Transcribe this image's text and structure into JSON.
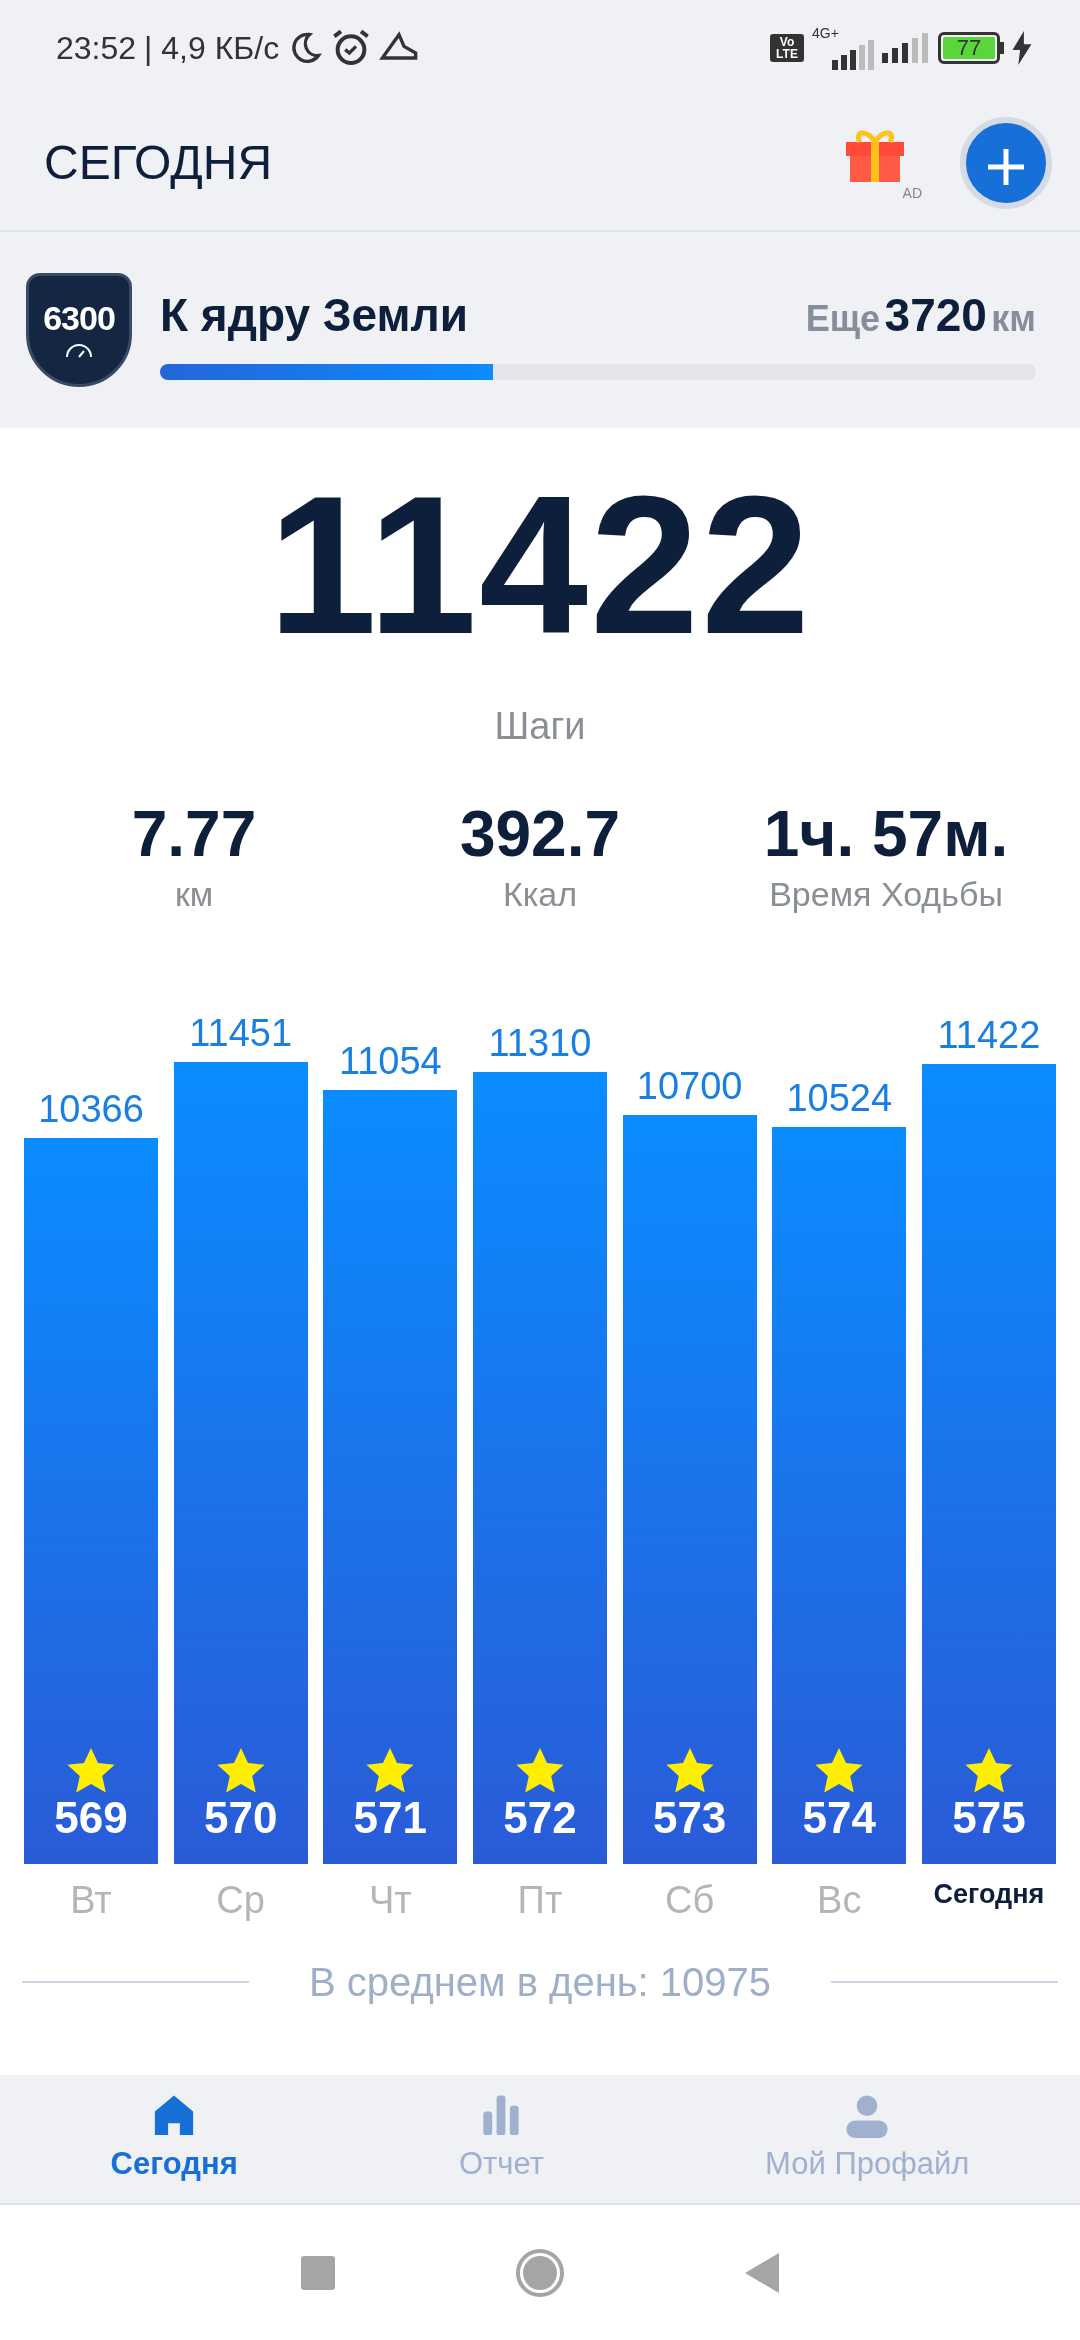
{
  "status_bar": {
    "time": "23:52",
    "speed": "| 4,9 КБ/с",
    "network": "4G+",
    "volte": "Vo LTE",
    "battery": "77"
  },
  "header": {
    "title": "СЕГОДНЯ",
    "gift_badge": "AD"
  },
  "goal": {
    "badge": "6300",
    "title": "К ядру Земли",
    "remaining_label": "Еще",
    "remaining_value": "3720",
    "remaining_unit": "км",
    "level": 0.38
  },
  "steps": {
    "value": "11422",
    "label": "Шаги"
  },
  "stats": [
    {
      "value": "7.77",
      "label": "км"
    },
    {
      "value": "392.7",
      "label": "Ккал"
    },
    {
      "value": "1ч. 57м.",
      "label": "Время Ходьбы"
    }
  ],
  "chart_data": {
    "type": "bar",
    "categories": [
      "Вт",
      "Ср",
      "Чт",
      "Пт",
      "Сб",
      "Вс",
      "Сегодня"
    ],
    "values": [
      10366,
      11451,
      11054,
      11310,
      10700,
      10524,
      11422
    ],
    "data_labels": true
  },
  "star_totals": [
    "569",
    "570",
    "571",
    "572",
    "573",
    "574",
    "575"
  ],
  "day_states": [
    {
      "selected": false
    },
    {
      "selected": false
    },
    {
      "selected": false
    },
    {
      "selected": false
    },
    {
      "selected": false
    },
    {
      "selected": false
    },
    {
      "selected": true
    }
  ],
  "average": "В среднем в день: 10975",
  "tabs": [
    {
      "label": "Сегодня",
      "selected": true
    },
    {
      "label": "Отчет",
      "selected": false
    },
    {
      "label": "Мой Профайл",
      "selected": false
    }
  ]
}
